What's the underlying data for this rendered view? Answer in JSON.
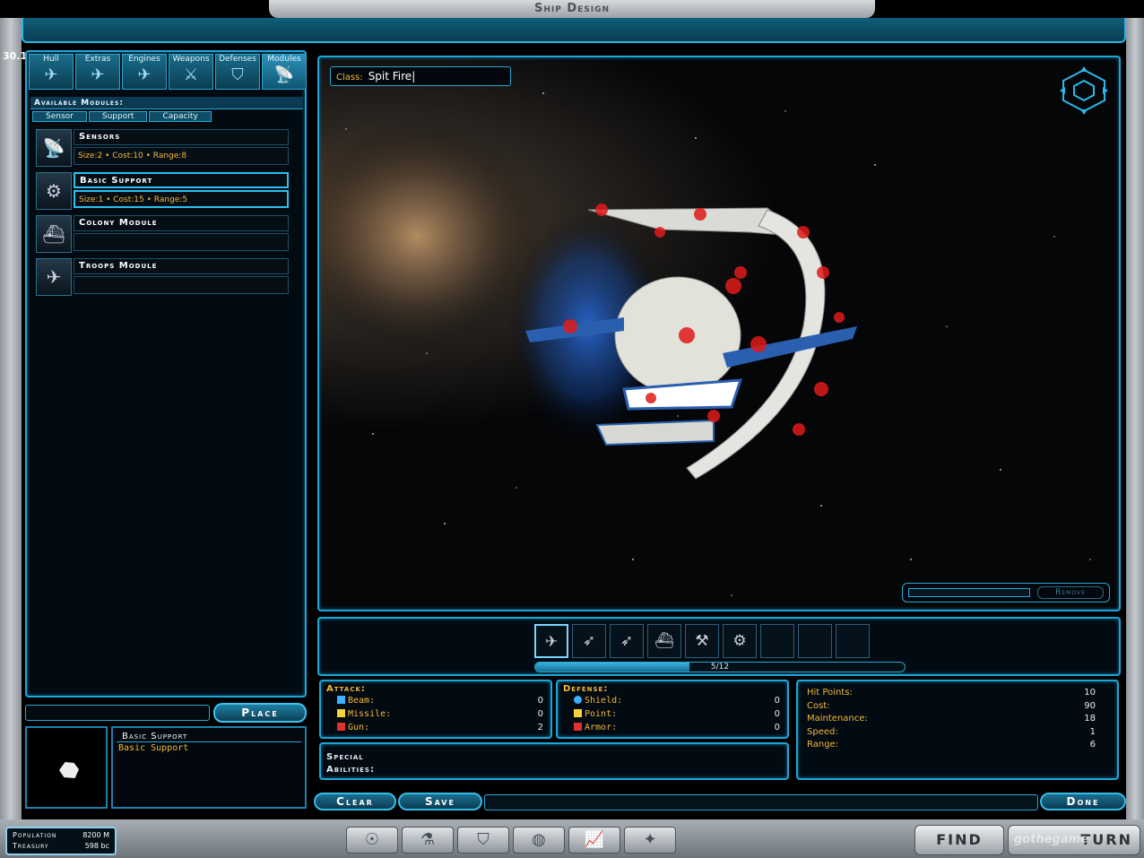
{
  "window": {
    "title": "Ship Design",
    "fps": "30.1"
  },
  "tabs": [
    {
      "label": "Hull",
      "icon": "ship-hull-icon"
    },
    {
      "label": "Extras",
      "icon": "extras-icon"
    },
    {
      "label": "Engines",
      "icon": "engine-icon"
    },
    {
      "label": "Weapons",
      "icon": "weapon-icon"
    },
    {
      "label": "Defenses",
      "icon": "shield-icon"
    },
    {
      "label": "Modules",
      "icon": "module-icon"
    }
  ],
  "modules_panel": {
    "heading": "Available Modules:",
    "subtabs": [
      "Sensor",
      "Support",
      "Capacity"
    ],
    "items": [
      {
        "name": "Sensors",
        "stats": "Size:2 • Cost:10 • Range:8",
        "icon": "sensor-dish-icon"
      },
      {
        "name": "Basic Support",
        "stats": "Size:1 • Cost:15 • Range:5",
        "icon": "support-module-icon"
      },
      {
        "name": "Colony Module",
        "stats": "",
        "icon": "colony-pod-icon"
      },
      {
        "name": "Troops Module",
        "stats": "",
        "icon": "troop-transport-icon"
      }
    ]
  },
  "place": {
    "label": "Place"
  },
  "description": {
    "title": "Basic Support",
    "text": "Basic Support"
  },
  "viewport": {
    "class_label": "Class:",
    "class_value": "Spit Fire|",
    "remove_label": "Remove"
  },
  "slots": {
    "items": [
      {
        "icon": "ship-hull-icon",
        "glyph": "✈"
      },
      {
        "icon": "engine-icon",
        "glyph": "➶"
      },
      {
        "icon": "engine-icon",
        "glyph": "➶"
      },
      {
        "icon": "colony-pod-icon",
        "glyph": "⛴"
      },
      {
        "icon": "weapon-icon",
        "glyph": "⚒"
      },
      {
        "icon": "support-module-icon",
        "glyph": "⚙"
      },
      {
        "icon": "empty-slot",
        "glyph": ""
      },
      {
        "icon": "empty-slot",
        "glyph": ""
      },
      {
        "icon": "empty-slot",
        "glyph": ""
      }
    ],
    "capacity_text": "5/12",
    "capacity_fraction": 0.4167
  },
  "attack": {
    "heading": "Attack:",
    "rows": [
      {
        "label": "Beam:",
        "value": "0",
        "color": "#3fb0ff"
      },
      {
        "label": "Missile:",
        "value": "0",
        "color": "#f6d23c"
      },
      {
        "label": "Gun:",
        "value": "2",
        "color": "#e33030"
      }
    ]
  },
  "defense": {
    "heading": "Defense:",
    "rows": [
      {
        "label": "Shield:",
        "value": "0",
        "color": "#3fb0ff"
      },
      {
        "label": "Point:",
        "value": "0",
        "color": "#f6d23c"
      },
      {
        "label": "Armor:",
        "value": "0",
        "color": "#e33030"
      }
    ]
  },
  "special": {
    "label_1": "Special",
    "label_2": "Abilities:"
  },
  "info": {
    "rows": [
      {
        "label": "Hit Points:",
        "value": "10"
      },
      {
        "label": "Cost:",
        "value": "90"
      },
      {
        "label": "Maintenance:",
        "value": "18"
      },
      {
        "label": "Speed:",
        "value": "1"
      },
      {
        "label": "Range:",
        "value": "6"
      }
    ]
  },
  "buttons": {
    "clear": "Clear",
    "save": "Save",
    "done": "Done"
  },
  "footer": {
    "population_label": "Population",
    "population_value": "8200 M",
    "treasury_label": "Treasury",
    "treasury_value": "598 bc",
    "find": "FIND",
    "turn": "TURN",
    "watermark": "gothegame"
  }
}
